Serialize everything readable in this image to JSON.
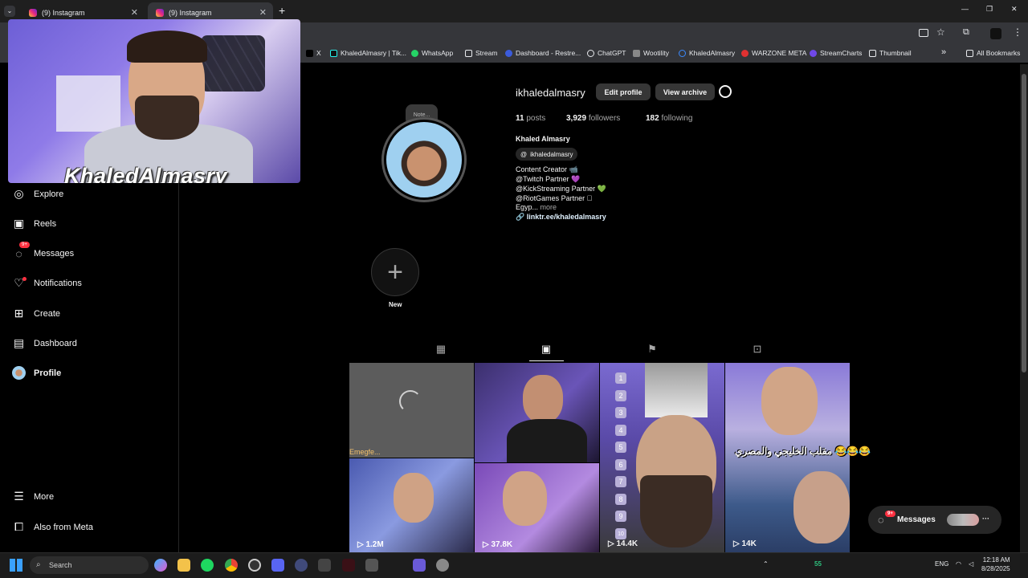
{
  "browser": {
    "tabs": [
      {
        "label": "(9) Instagram",
        "active": false
      },
      {
        "label": "(9) Instagram",
        "active": true
      }
    ],
    "new_tab": "+",
    "window_controls": {
      "minimize": "—",
      "restore": "❐",
      "close": "✕"
    }
  },
  "bookmarks": {
    "items": [
      "X",
      "KhaledAlmasry | Tik...",
      "WhatsApp",
      "Stream",
      "Dashboard - Restre...",
      "ChatGPT",
      "Wootility",
      "KhaledAlmasry",
      "WARZONE META",
      "StreamCharts",
      "Thumbnail"
    ],
    "overflow": "»",
    "all_bookmarks": "All Bookmarks"
  },
  "overlay": {
    "streamer_name": "KhaledAlmasry"
  },
  "sidebar": {
    "items": [
      {
        "label": "Explore",
        "icon": "compass-icon"
      },
      {
        "label": "Reels",
        "icon": "reels-icon"
      },
      {
        "label": "Messages",
        "icon": "messenger-icon",
        "badge": "9+"
      },
      {
        "label": "Notifications",
        "icon": "heart-icon",
        "dot": true
      },
      {
        "label": "Create",
        "icon": "plus-square-icon"
      },
      {
        "label": "Dashboard",
        "icon": "chart-icon"
      },
      {
        "label": "Profile",
        "icon": "avatar-icon"
      }
    ],
    "bottom": [
      {
        "label": "More",
        "icon": "hamburger-icon"
      },
      {
        "label": "Also from Meta",
        "icon": "meta-icon"
      }
    ]
  },
  "profile": {
    "note": "Note...",
    "username": "ikhaledalmasry",
    "edit_profile": "Edit profile",
    "view_archive": "View archive",
    "stats": {
      "posts_count": "11",
      "posts_label": "posts",
      "followers_count": "3,929",
      "followers_label": "followers",
      "following_count": "182",
      "following_label": "following"
    },
    "full_name": "Khaled Almasry",
    "threads_handle": "ikhaledalmasry",
    "bio_lines": [
      "Content Creator 📹",
      "@Twitch Partner 💜",
      "@KickStreaming Partner 💚",
      "@RiotGames Partner 🏻"
    ],
    "bio_truncated": "Egyp...",
    "bio_more": "more",
    "link": "linktr.ee/khaledalmasry",
    "new_highlight": "New"
  },
  "grid": {
    "tiles": [
      {
        "views": "",
        "overlay_text": "Emegfe..."
      },
      {
        "views": ""
      },
      {
        "views": "",
        "numbers": [
          "1",
          "2",
          "3",
          "4",
          "5",
          "6",
          "7",
          "8",
          "9",
          "10"
        ]
      },
      {
        "views": "",
        "overlay_text": "مقلب الخليجي والمصري 😂😂😂"
      },
      {
        "views": "1.2M"
      },
      {
        "views": "37.8K"
      },
      {
        "views": "14.4K"
      },
      {
        "views": "14K"
      }
    ]
  },
  "messages_pill": {
    "label": "Messages",
    "badge": "9+"
  },
  "taskbar": {
    "search": "Search",
    "tray_temp": "55",
    "language": "ENG",
    "time": "12:18 AM",
    "date": "8/28/2025"
  }
}
